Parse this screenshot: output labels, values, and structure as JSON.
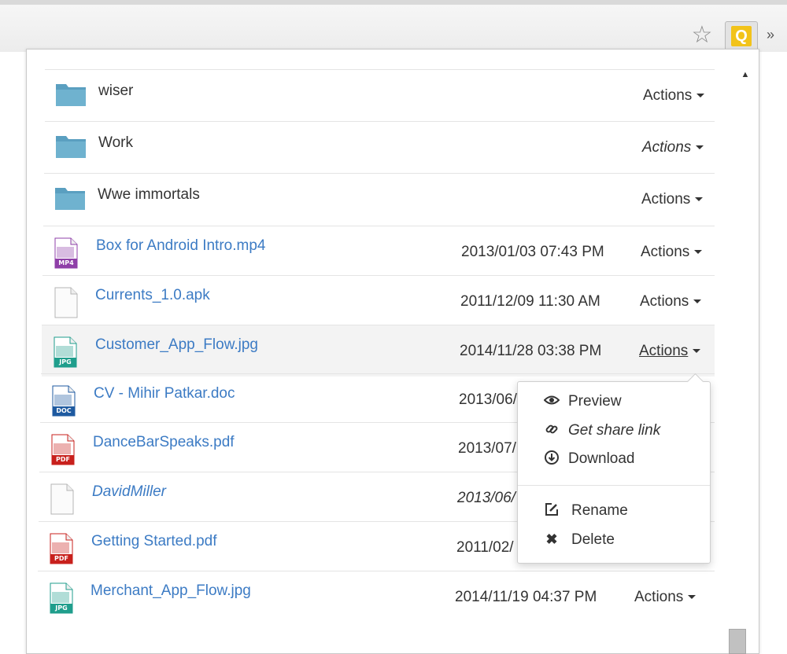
{
  "popup": {
    "rows": [
      {
        "name": "wiser",
        "kind": "folder",
        "date": "",
        "actions": "Actions"
      },
      {
        "name": "Work",
        "kind": "folder",
        "date": "",
        "actions": "Actions"
      },
      {
        "name": "Wwe immortals",
        "kind": "folder",
        "date": "",
        "actions": "Actions"
      },
      {
        "name": "Box for Android Intro.mp4",
        "kind": "mp4",
        "icon_label": "MP4",
        "date": "2013/01/03 07:43 PM",
        "actions": "Actions"
      },
      {
        "name": "Currents_1.0.apk",
        "kind": "generic",
        "date": "2011/12/09 11:30 AM",
        "actions": "Actions"
      },
      {
        "name": "Customer_App_Flow.jpg",
        "kind": "jpg",
        "icon_label": "JPG",
        "date": "2014/11/28 03:38 PM",
        "actions": "Actions"
      },
      {
        "name": "CV - Mihir Patkar.doc",
        "kind": "doc",
        "icon_label": "DOC",
        "date": "2013/06/",
        "actions": ""
      },
      {
        "name": "DanceBarSpeaks.pdf",
        "kind": "pdf",
        "icon_label": "PDF",
        "date": "2013/07/",
        "actions": ""
      },
      {
        "name": "DavidMiller",
        "kind": "generic",
        "date": "2013/06/",
        "actions": ""
      },
      {
        "name": "Getting Started.pdf",
        "kind": "pdf",
        "icon_label": "PDF",
        "date": "2011/02/",
        "actions": ""
      },
      {
        "name": "Merchant_App_Flow.jpg",
        "kind": "jpg",
        "icon_label": "JPG",
        "date": "2014/11/19 04:37 PM",
        "actions": "Actions"
      }
    ]
  },
  "menu": {
    "items": [
      {
        "label": "Preview",
        "icon": "eye-icon"
      },
      {
        "label": "Get share link",
        "icon": "link-icon"
      },
      {
        "label": "Download",
        "icon": "download-icon"
      },
      {
        "label": "Rename",
        "icon": "edit-icon"
      },
      {
        "label": "Delete",
        "icon": "close-icon"
      }
    ]
  },
  "toolbar": {
    "extension_letter": "Q"
  },
  "colors": {
    "folder": "#5a9fc0",
    "link": "#3c7bc4",
    "pdf": "#c8201c",
    "jpg": "#1f9e8c",
    "mp4": "#8f3fa8",
    "doc": "#1e5aa0",
    "ext": "#f2c31a"
  }
}
